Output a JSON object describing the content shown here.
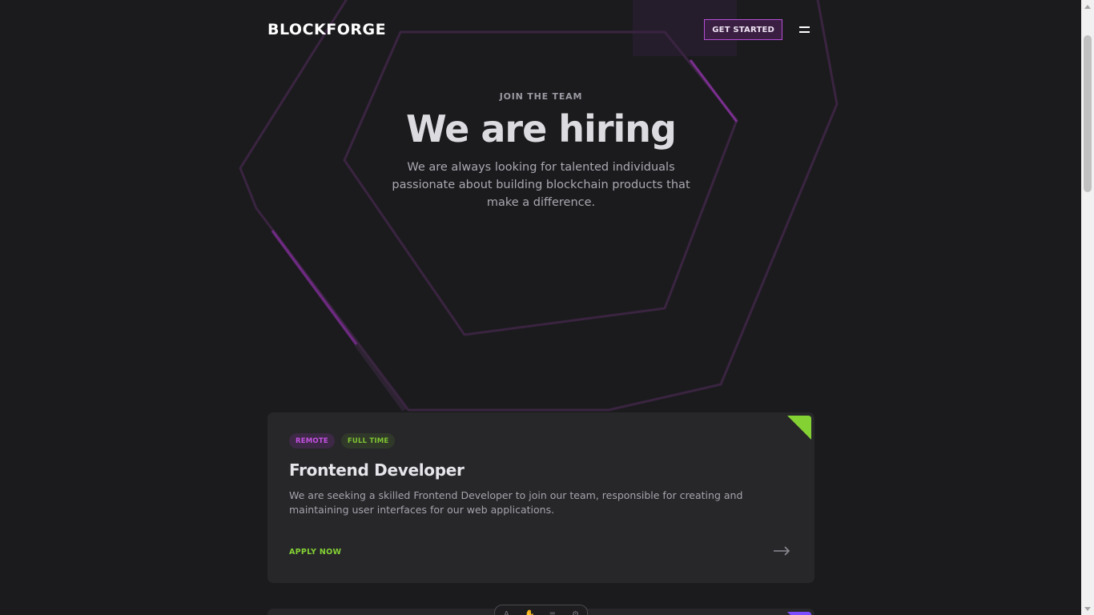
{
  "header": {
    "logo": "BLOCKFORGE",
    "cta_label": "GET STARTED",
    "menu_icon": "hamburger-menu-icon"
  },
  "hero": {
    "eyebrow": "JOIN THE TEAM",
    "title": "We are hiring",
    "description": "We are always looking for talented individuals passionate about building blockchain products that make a difference."
  },
  "jobs": [
    {
      "tags": [
        "REMOTE",
        "FULL TIME"
      ],
      "title": "Frontend Developer",
      "description": "We are seeking a skilled Frontend Developer to join our team, responsible for creating and maintaining user interfaces for our web applications.",
      "apply_label": "APPLY NOW",
      "arrow_icon": "arrow-right-icon"
    }
  ],
  "colors": {
    "background": "#1b1b1e",
    "card": "#27272a",
    "accent_purple": "#b64ed6",
    "accent_green": "#84d134",
    "accent_violet": "#7c4dff"
  },
  "toolbar_icons": [
    "text-icon",
    "hand-icon",
    "filter-icon",
    "settings-icon"
  ]
}
